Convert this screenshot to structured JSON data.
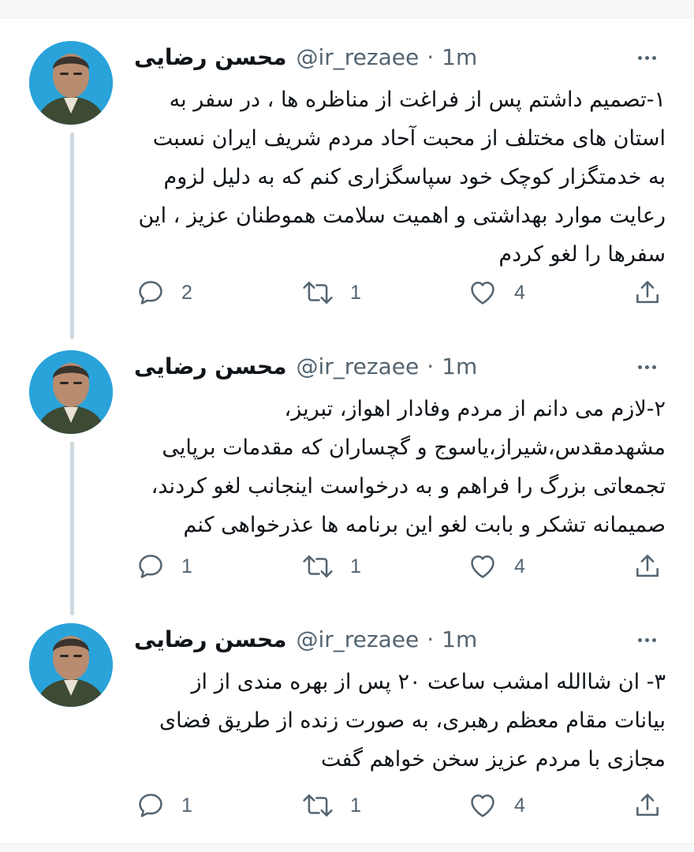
{
  "author": {
    "name": "محسن رضایی",
    "handle": "@ir_rezaee",
    "separator": "·",
    "time": "1m"
  },
  "colors": {
    "text": "#0f1419",
    "secondary": "#536471",
    "thread_line": "#cfd9de",
    "avatar_bg": "#29a3da"
  },
  "icons": {
    "reply": "reply-icon",
    "retweet": "retweet-icon",
    "like": "heart-icon",
    "share": "share-icon",
    "more": "more-icon"
  },
  "tweets": [
    {
      "lines": [
        "۱-تصمیم داشتم پس از فراغت از مناظره ها ، در سفر به",
        "استان های مختلف از محبت آحاد مردم شریف ایران نسبت",
        "به خدمتگزار کوچک خود سپاسگزاری کنم که به دلیل لزوم",
        "رعایت موارد بهداشتی و اهمیت سلامت هموطنان عزیز ، این",
        "سفرها را لغو کردم"
      ],
      "replies": "2",
      "retweets": "1",
      "likes": "4"
    },
    {
      "lines": [
        "۲-لازم می دانم از مردم وفادار اهواز، تبریز،",
        "مشهدمقدس،شیراز،یاسوج و گچساران که مقدمات برپایی",
        "تجمعاتی بزرگ را فراهم و به درخواست اینجانب لغو کردند،",
        "صمیمانه تشکر و بابت لغو این برنامه ها عذرخواهی کنم"
      ],
      "replies": "1",
      "retweets": "1",
      "likes": "4"
    },
    {
      "lines": [
        "۳- ان شاالله امشب ساعت ۲۰ پس از بهره مندی از از",
        "بیانات مقام معظم رهبری، به صورت زنده از طریق فضای",
        "مجازی با مردم عزیز سخن خواهم گفت"
      ],
      "replies": "1",
      "retweets": "1",
      "likes": "4"
    }
  ]
}
